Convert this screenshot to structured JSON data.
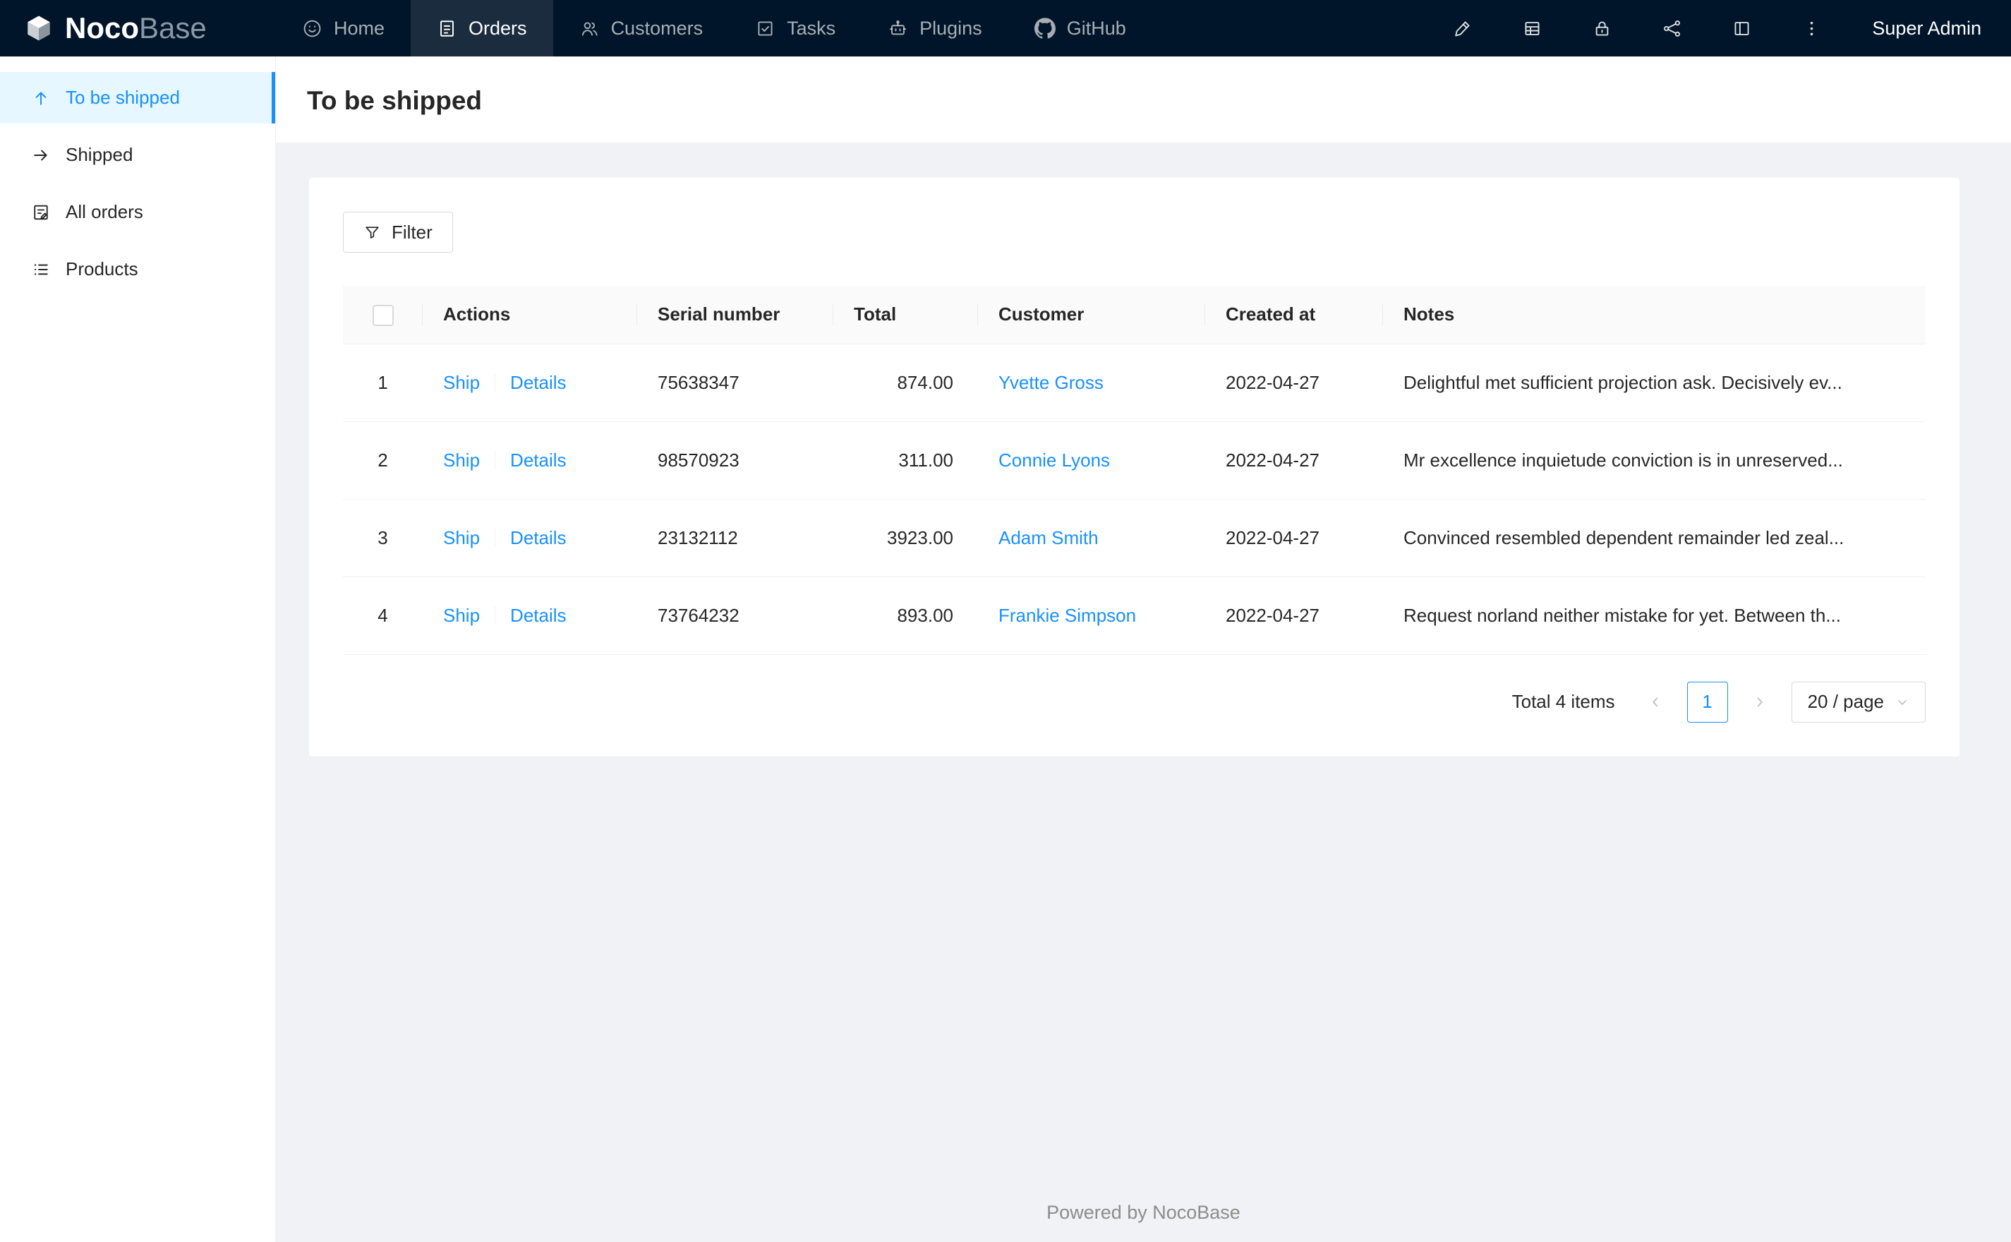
{
  "colors": {
    "accent": "#1890ff",
    "header_bg": "#001529",
    "active_side_bg": "#e6f7ff"
  },
  "header": {
    "logo": {
      "primary": "Noco",
      "secondary": "Base"
    },
    "nav": [
      {
        "label": "Home",
        "icon": "home-icon",
        "active": false
      },
      {
        "label": "Orders",
        "icon": "orders-icon",
        "active": true
      },
      {
        "label": "Customers",
        "icon": "customers-icon",
        "active": false
      },
      {
        "label": "Tasks",
        "icon": "tasks-icon",
        "active": false
      },
      {
        "label": "Plugins",
        "icon": "plugins-icon",
        "active": false
      },
      {
        "label": "GitHub",
        "icon": "github-icon",
        "active": false
      }
    ],
    "right_icons": [
      "highlighter-icon",
      "collections-icon",
      "lock-icon",
      "hierarchy-icon",
      "layout-icon",
      "ellipsis-icon"
    ],
    "user": "Super Admin"
  },
  "sidebar": {
    "items": [
      {
        "label": "To be shipped",
        "icon": "arrow-up-icon",
        "active": true
      },
      {
        "label": "Shipped",
        "icon": "arrow-right-icon",
        "active": false
      },
      {
        "label": "All orders",
        "icon": "form-icon",
        "active": false
      },
      {
        "label": "Products",
        "icon": "list-icon",
        "active": false
      }
    ]
  },
  "page": {
    "title": "To be shipped"
  },
  "toolbar": {
    "filter_label": "Filter"
  },
  "table": {
    "columns": [
      "Actions",
      "Serial number",
      "Total",
      "Customer",
      "Created at",
      "Notes"
    ],
    "rows": [
      {
        "index": "1",
        "actions": [
          "Ship",
          "Details"
        ],
        "serial": "75638347",
        "total": "874.00",
        "customer": "Yvette Gross",
        "created_at": "2022-04-27",
        "notes": "Delightful met sufficient projection ask. Decisively ev..."
      },
      {
        "index": "2",
        "actions": [
          "Ship",
          "Details"
        ],
        "serial": "98570923",
        "total": "311.00",
        "customer": "Connie Lyons",
        "created_at": "2022-04-27",
        "notes": "Mr excellence inquietude conviction is in unreserved..."
      },
      {
        "index": "3",
        "actions": [
          "Ship",
          "Details"
        ],
        "serial": "23132112",
        "total": "3923.00",
        "customer": "Adam Smith",
        "created_at": "2022-04-27",
        "notes": "Convinced resembled dependent remainder led zeal..."
      },
      {
        "index": "4",
        "actions": [
          "Ship",
          "Details"
        ],
        "serial": "73764232",
        "total": "893.00",
        "customer": "Frankie Simpson",
        "created_at": "2022-04-27",
        "notes": "Request norland neither mistake for yet. Between th..."
      }
    ]
  },
  "pagination": {
    "total_text": "Total 4 items",
    "prev": "‹",
    "current_page": "1",
    "next": "›",
    "page_size": "20 / page"
  },
  "footer": {
    "text": "Powered by NocoBase"
  }
}
